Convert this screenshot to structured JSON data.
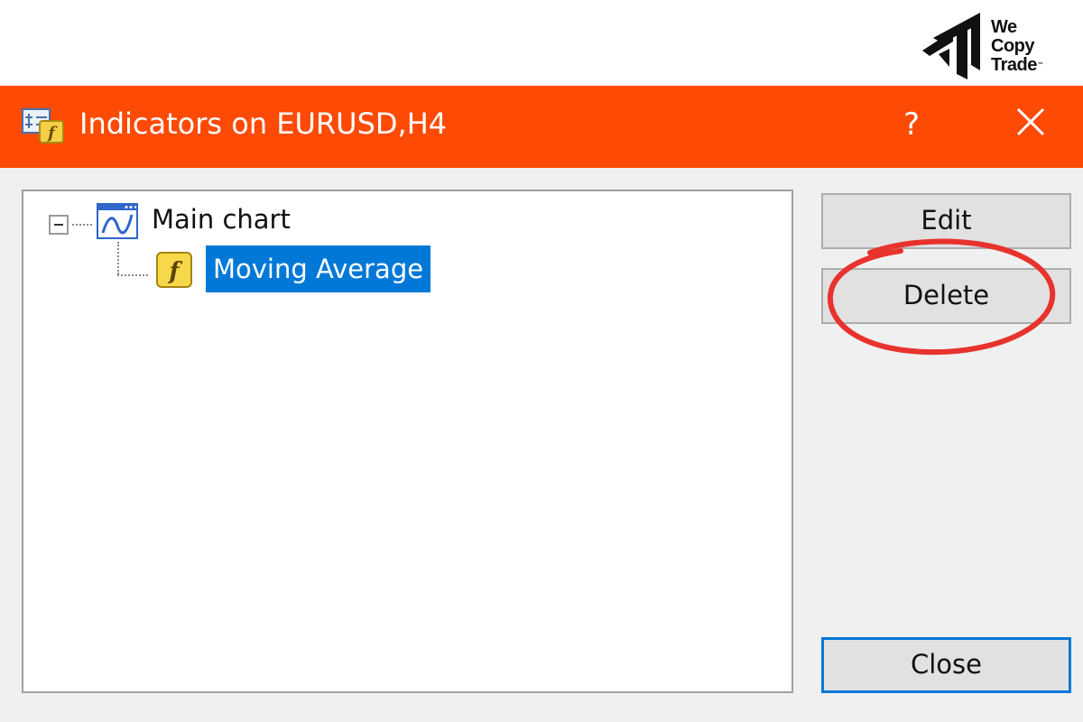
{
  "brand": {
    "lines": [
      "We",
      "Copy",
      "Trade"
    ],
    "trademark": "™"
  },
  "titlebar": {
    "icon": "indicator-list-icon",
    "title": "Indicators on EURUSD,H4",
    "help_label": "?",
    "close_icon": "close-icon",
    "background_color": "#fd4a05"
  },
  "tree": {
    "root": {
      "label": "Main chart",
      "icon": "chart-window-icon",
      "expanded": true
    },
    "children": [
      {
        "label": "Moving Average",
        "icon": "function-icon",
        "selected": true
      }
    ]
  },
  "buttons": {
    "edit": "Edit",
    "delete": "Delete",
    "close": "Close"
  },
  "annotation": {
    "target": "delete-button",
    "color": "#e8322d"
  },
  "colors": {
    "selection": "#0078d7",
    "dialog_background": "#f0f0f0"
  }
}
